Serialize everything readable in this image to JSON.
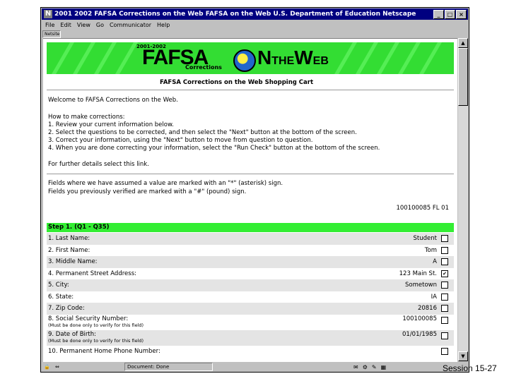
{
  "window": {
    "title": "2001 2002 FAFSA Corrections on the Web   FAFSA on the Web   U.S. Department of Education   Netscape",
    "buttons": {
      "minimize": "_",
      "maximize": "□",
      "close": "×"
    }
  },
  "menu": [
    "File",
    "Edit",
    "View",
    "Go",
    "Communicator",
    "Help"
  ],
  "location_label": "Netsite",
  "banner": {
    "year": "2001-2002",
    "fafsa": "FAFSA",
    "corrections": "Corrections",
    "on": "N",
    "the": "THE",
    "web_w": "W",
    "web_eb": "EB"
  },
  "page_heading": "FAFSA Corrections on the Web Shopping Cart",
  "intro": "Welcome to FAFSA Corrections on the Web.",
  "howto": {
    "title": "How to make corrections:",
    "steps": [
      "1. Review your current information below.",
      "2. Select the questions to be corrected, and then select the \"Next\" button at the bottom of the screen.",
      "3. Correct your information, using the \"Next\" button to move from question to question.",
      "4. When you are done correcting your information, select the \"Run Check\" button at the bottom of the screen."
    ]
  },
  "details": "For further details select this link.",
  "notes": [
    "Fields where we have assumed a value are marked with an \"*\" (asterisk) sign.",
    "Fields you previously verified are marked with a \"#\" (pound) sign."
  ],
  "ref_number": "100100085 FL 01",
  "step_header": "Step 1. (Q1 - Q35)",
  "rows": [
    {
      "label": "1. Last Name:",
      "value": "Student",
      "checked": false
    },
    {
      "label": "2. First Name:",
      "value": "Tom",
      "checked": false
    },
    {
      "label": "3. Middle Name:",
      "value": "A",
      "checked": false
    },
    {
      "label": "4. Permanent Street Address:",
      "value": "123 Main St.",
      "checked": true
    },
    {
      "label": "5. City:",
      "value": "Sometown",
      "checked": false
    },
    {
      "label": "6. State:",
      "value": "IA",
      "checked": false
    },
    {
      "label": "7. Zip Code:",
      "value": "20816",
      "checked": false
    },
    {
      "label": "8. Social Security Number:",
      "note": "(Must be done only to verify for this field)",
      "value": "100100085",
      "checked": false
    },
    {
      "label": "9. Date of Birth:",
      "note": "(Must be done only to verify for this field)",
      "value": "01/01/1985",
      "checked": false
    },
    {
      "label": "10. Permanent Home Phone Number:",
      "value": "",
      "checked": false
    }
  ],
  "status": {
    "text": "Document: Done"
  },
  "slide_label": "Session 15-27"
}
